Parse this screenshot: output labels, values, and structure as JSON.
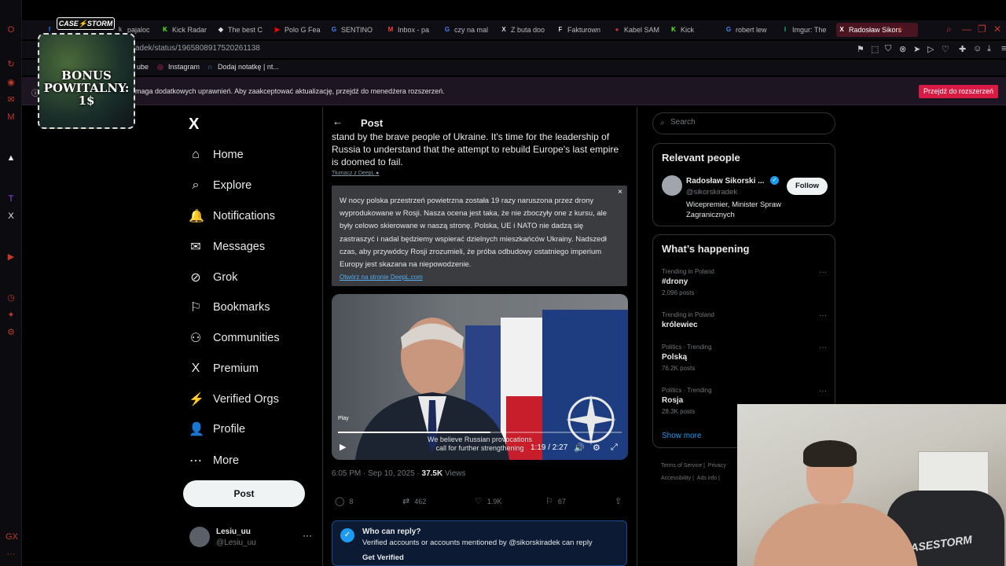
{
  "browser": {
    "tabs": [
      {
        "icon": "f",
        "color": "#1877f2",
        "label": ""
      },
      {
        "icon": "k",
        "color": "#888",
        "label": "pajaloc"
      },
      {
        "icon": "K",
        "color": "#53fc18",
        "label": "Kick Radar"
      },
      {
        "icon": "◆",
        "color": "#ddd",
        "label": "The best C"
      },
      {
        "icon": "▶",
        "color": "#ff0000",
        "label": "Polo G Fea"
      },
      {
        "icon": "G",
        "color": "#4285f4",
        "label": "SENTINO"
      },
      {
        "icon": "M",
        "color": "#ea4335",
        "label": "Inbox - pa"
      },
      {
        "icon": "G",
        "color": "#4285f4",
        "label": "czy na mal"
      },
      {
        "icon": "X",
        "color": "#ddd",
        "label": "Z buta doo"
      },
      {
        "icon": "F",
        "color": "#ddd",
        "label": "Fakturown"
      },
      {
        "icon": "●",
        "color": "#c0392b",
        "label": "Kabel SAM"
      },
      {
        "icon": "K",
        "color": "#53fc18",
        "label": "Kick"
      },
      {
        "icon": "G",
        "color": "#4285f4",
        "label": "robert lew"
      },
      {
        "icon": "I",
        "color": "#1bb76e",
        "label": "Imgur: The"
      },
      {
        "icon": "X",
        "color": "#fff",
        "label": "Radosław Sikors"
      }
    ],
    "url": "adek/status/1965808917520261138",
    "bookmarks": [
      {
        "label": "ube"
      },
      {
        "label": "Instagram"
      },
      {
        "label": "Dodaj notatkę | nt..."
      }
    ],
    "ext_warning": "maga dodatkowych uprawnień. Aby zaakceptować aktualizację, przejdź do menedżera rozszerzeń.",
    "ext_button": "Przejdź do rozszerzeń"
  },
  "overlay": {
    "logo": "CASE⚡STORM",
    "bonus": "BONUS POWITALNY: 1$"
  },
  "nav": {
    "logo": "X",
    "items": [
      {
        "icon": "⌂",
        "label": "Home"
      },
      {
        "icon": "⌕",
        "label": "Explore"
      },
      {
        "icon": "🔔",
        "label": "Notifications"
      },
      {
        "icon": "✉",
        "label": "Messages"
      },
      {
        "icon": "⊘",
        "label": "Grok"
      },
      {
        "icon": "⚐",
        "label": "Bookmarks"
      },
      {
        "icon": "⚇",
        "label": "Communities"
      },
      {
        "icon": "X",
        "label": "Premium"
      },
      {
        "icon": "⚡",
        "label": "Verified Orgs"
      },
      {
        "icon": "👤",
        "label": "Profile"
      },
      {
        "icon": "⋯",
        "label": "More"
      }
    ],
    "post_button": "Post",
    "account": {
      "name": "Lesiu_uu",
      "handle": "@Lesiu_uu",
      "more": "···"
    }
  },
  "post": {
    "header_title": "Post",
    "text": "stand by the brave people of Ukraine. It's time for the leadership of Russia to understand that the attempt to rebuild Europe's last empire is doomed to fail.",
    "translated_by": "Tłumacz z DeepL",
    "translation": "W nocy polska przestrzeń powietrzna została 19 razy naruszona przez drony wyprodukowane w Rosji. Nasza ocena jest taka, że nie zboczyły one z kursu, ale były celowo skierowane w naszą stronę. Polska, UE i NATO nie dadzą się zastraszyć i nadal będziemy wspierać dzielnych mieszkańców Ukrainy. Nadszedł czas, aby przywódcy Rosji zrozumieli, że próba odbudowy ostatniego imperium Europy jest skazana na niepowodzenie.",
    "translation_link": "Otwórz na stronie DeepL.com",
    "translation_close": "×",
    "video": {
      "play_label": "Play",
      "subtitle_line1": "We believe Russian provocations",
      "subtitle_line2": "call for further strengthening",
      "time": "1:19 / 2:27",
      "progress": 0.537
    },
    "time": "6:05 PM · Sep 10, 2025 · ",
    "views_count": "37.5K",
    "views_label": " Views",
    "actions": {
      "replies": "8",
      "reposts": "462",
      "likes": "1.9K",
      "bookmarks": "67"
    },
    "reply_box": {
      "title": "Who can reply?",
      "desc": "Verified accounts or accounts mentioned by @sikorskiradek can reply",
      "link": "Get Verified"
    }
  },
  "sidebar": {
    "search_placeholder": "Search",
    "relevant_title": "Relevant people",
    "person": {
      "name": "Radosław Sikorski ...",
      "handle": "@sikorskiradek",
      "bio": "Wicepremier, Minister Spraw Zagranicznych",
      "follow": "Follow"
    },
    "happening_title": "What’s happening",
    "trends": [
      {
        "context": "Trending in Poland",
        "name": "#drony",
        "count": "2,096 posts"
      },
      {
        "context": "Trending in Poland",
        "name": "królewiec",
        "count": ""
      },
      {
        "context": "Politics · Trending",
        "name": "Polską",
        "count": "76.2K posts"
      },
      {
        "context": "Politics · Trending",
        "name": "Rosja",
        "count": "28.3K posts"
      }
    ],
    "show_more": "Show more",
    "footer": [
      "Terms of Service |",
      "Privacy",
      "Accessibility |",
      "Ads info |"
    ]
  },
  "webcam": {
    "chair_brand": "CASESTORM"
  }
}
